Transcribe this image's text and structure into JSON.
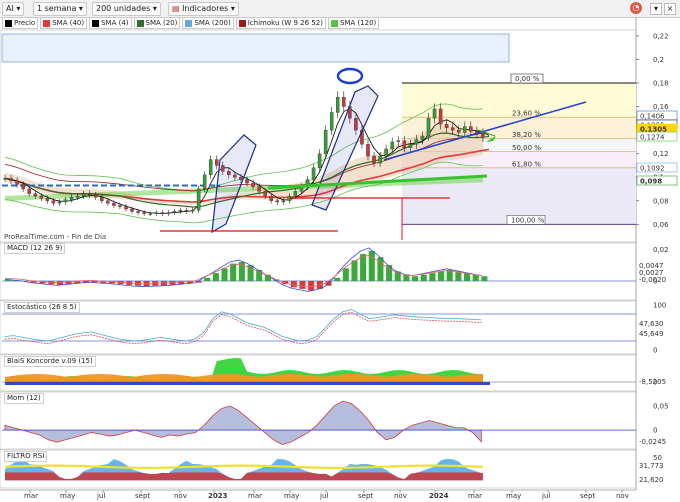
{
  "toolbar": {
    "symbol": "AI",
    "interval": "1 semana",
    "units": "200 unidades",
    "indicators": "Indicadores",
    "colors": {
      "bg": "#f1f1f1",
      "alert_icon": "#e05a4a"
    }
  },
  "legend": [
    {
      "label": "Precio",
      "color": "#000000"
    },
    {
      "label": "SMA (40)",
      "color": "#e33b3b"
    },
    {
      "label": "SMA (4)",
      "color": "#000000"
    },
    {
      "label": "SMA (20)",
      "color": "#2f6e2f"
    },
    {
      "label": "SMA (200)",
      "color": "#6aa6d9"
    },
    {
      "label": "Ichimoku (W 9 26 52)",
      "color": "#9b1a1a"
    },
    {
      "label": "SMA (120)",
      "color": "#58c23f"
    }
  ],
  "source_label": "ProRealTime.com - Fin de Día",
  "chart_data": [
    {
      "type": "candlestick",
      "title": "Precio",
      "x_months": [
        "mar",
        "may",
        "jul",
        "sept",
        "nov",
        "2023",
        "mar",
        "may",
        "jul",
        "sept",
        "nov",
        "2024",
        "mar",
        "may",
        "jul",
        "sept",
        "nov"
      ],
      "y_ticks": [
        "0,22",
        "0,2",
        "0,18",
        "0,16",
        "0,14",
        "0,12",
        "0,1",
        "0,08",
        "0,06"
      ],
      "ylim": [
        0.045,
        0.225
      ],
      "close": [
        0.099,
        0.097,
        0.094,
        0.09,
        0.086,
        0.084,
        0.082,
        0.08,
        0.078,
        0.079,
        0.081,
        0.083,
        0.084,
        0.086,
        0.085,
        0.083,
        0.08,
        0.078,
        0.076,
        0.075,
        0.073,
        0.071,
        0.07,
        0.069,
        0.069,
        0.07,
        0.069,
        0.07,
        0.071,
        0.072,
        0.071,
        0.072,
        0.09,
        0.102,
        0.115,
        0.11,
        0.105,
        0.102,
        0.1,
        0.098,
        0.095,
        0.092,
        0.088,
        0.084,
        0.08,
        0.079,
        0.08,
        0.084,
        0.088,
        0.092,
        0.098,
        0.108,
        0.12,
        0.14,
        0.155,
        0.168,
        0.16,
        0.15,
        0.14,
        0.128,
        0.118,
        0.112,
        0.118,
        0.124,
        0.13,
        0.131,
        0.125,
        0.128,
        0.132,
        0.135,
        0.15,
        0.158,
        0.145,
        0.142,
        0.14,
        0.138,
        0.143,
        0.139,
        0.1375,
        0.134,
        0.131
      ],
      "fib_levels": [
        {
          "label": "0,00 %",
          "value": 0.18
        },
        {
          "label": "23,60 %",
          "value": 0.151
        },
        {
          "label": "38,20 %",
          "value": 0.133
        },
        {
          "label": "50,00 %",
          "value": 0.122
        },
        {
          "label": "61,80 %",
          "value": 0.108
        },
        {
          "label": "100,00 %",
          "value": 0.06
        }
      ],
      "price_tags": [
        {
          "label": "0,1406",
          "color": "#2d6cc2"
        },
        {
          "label": "0,1355",
          "color": "#222222"
        },
        {
          "label": "0,1305",
          "color": "#ffd700"
        },
        {
          "label": "0,1274",
          "color": "#58c23f"
        },
        {
          "label": "0,1092",
          "color": "#6aa6d9"
        },
        {
          "label": "0,098",
          "color": "#2f9e2f"
        }
      ]
    },
    {
      "type": "line",
      "title": "MACD (12 26 9)",
      "y_ticks": [
        "0,02",
        "0"
      ],
      "ylim": [
        -0.012,
        0.024
      ],
      "values": [
        0.001,
        0.0005,
        0,
        -0.001,
        -0.0015,
        -0.002,
        -0.0025,
        -0.002,
        -0.0015,
        -0.001,
        -0.0008,
        -0.0012,
        -0.0015,
        -0.002,
        -0.0025,
        -0.003,
        -0.0032,
        -0.003,
        -0.0028,
        -0.0025,
        -0.002,
        -0.0015,
        -0.001,
        0.002,
        0.005,
        0.008,
        0.011,
        0.012,
        0.01,
        0.007,
        0.004,
        0.001,
        -0.002,
        -0.004,
        -0.005,
        -0.006,
        -0.005,
        -0.003,
        0.002,
        0.008,
        0.013,
        0.017,
        0.019,
        0.015,
        0.01,
        0.006,
        0.004,
        0.003,
        0.004,
        0.005,
        0.006,
        0.007,
        0.006,
        0.005,
        0.004,
        0.003
      ],
      "tags": [
        "0,0047",
        "0,0027",
        "-0,0020"
      ]
    },
    {
      "type": "line",
      "title": "Estocástico (26 8 5)",
      "y_ticks": [
        "100",
        "0"
      ],
      "ylim": [
        0,
        100
      ],
      "values": [
        30,
        32,
        28,
        25,
        22,
        20,
        25,
        30,
        35,
        38,
        40,
        35,
        30,
        25,
        22,
        20,
        22,
        25,
        28,
        25,
        22,
        20,
        25,
        40,
        70,
        85,
        80,
        70,
        60,
        55,
        50,
        40,
        30,
        25,
        20,
        22,
        30,
        50,
        70,
        85,
        90,
        80,
        70,
        72,
        75,
        78,
        76,
        74,
        73,
        72,
        71,
        70,
        70,
        69,
        68,
        67
      ],
      "tags": [
        "47,630",
        "45,649"
      ]
    },
    {
      "type": "area",
      "title": "BlaiS Koncorde v.09 (15)",
      "y_ticks": [
        "0"
      ],
      "ylim": [
        -15,
        15
      ],
      "tags": [
        "-8,5205"
      ]
    },
    {
      "type": "area",
      "title": "Mom (12)",
      "y_ticks": [
        "0,05",
        "0"
      ],
      "ylim": [
        -0.035,
        0.075
      ],
      "values": [
        0.01,
        0.005,
        0,
        -0.005,
        -0.01,
        -0.02,
        -0.025,
        -0.02,
        -0.015,
        -0.01,
        -0.005,
        -0.008,
        -0.012,
        -0.01,
        -0.005,
        0,
        -0.005,
        -0.01,
        -0.015,
        -0.01,
        -0.012,
        -0.008,
        -0.005,
        0.01,
        0.03,
        0.045,
        0.05,
        0.04,
        0.025,
        0.01,
        -0.005,
        -0.02,
        -0.03,
        -0.025,
        -0.015,
        -0.005,
        0.01,
        0.03,
        0.05,
        0.06,
        0.055,
        0.04,
        0.02,
        -0.005,
        -0.02,
        -0.015,
        0,
        0.01,
        0.015,
        0.02,
        0.015,
        0.01,
        0.005,
        0.005,
        -0.005,
        -0.024
      ],
      "tags": [
        "-0,0245"
      ]
    },
    {
      "type": "area",
      "title": "FILTRO RSI",
      "y_ticks": [
        "50",
        "0"
      ],
      "ylim": [
        0,
        60
      ],
      "tags": [
        "31,773",
        "21,620"
      ]
    }
  ]
}
